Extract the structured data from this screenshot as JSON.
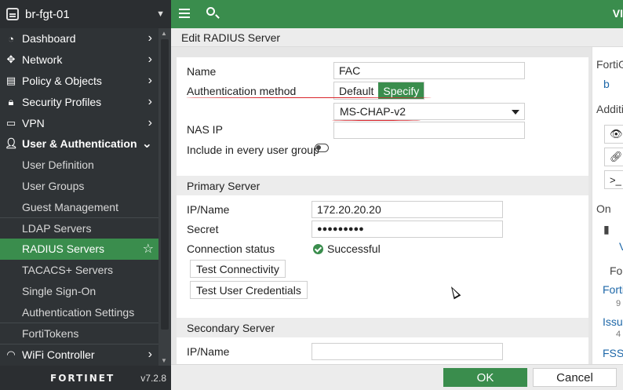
{
  "device": {
    "name": "br-fgt-01"
  },
  "sidebar": {
    "items": [
      {
        "label": "Dashboard",
        "icon": "dashboard-icon"
      },
      {
        "label": "Network",
        "icon": "network-icon"
      },
      {
        "label": "Policy & Objects",
        "icon": "policy-icon"
      },
      {
        "label": "Security Profiles",
        "icon": "lock-icon"
      },
      {
        "label": "VPN",
        "icon": "monitor-icon"
      },
      {
        "label": "User & Authentication",
        "icon": "user-icon"
      },
      {
        "label": "User Definition"
      },
      {
        "label": "User Groups"
      },
      {
        "label": "Guest Management"
      },
      {
        "label": "LDAP Servers"
      },
      {
        "label": "RADIUS Servers"
      },
      {
        "label": "TACACS+ Servers"
      },
      {
        "label": "Single Sign-On"
      },
      {
        "label": "Authentication Settings"
      },
      {
        "label": "FortiTokens"
      },
      {
        "label": "WiFi Controller",
        "icon": "wifi-icon"
      }
    ],
    "brand": "FORTINET",
    "version": "v7.2.8"
  },
  "topbar": {
    "right_text": "VI"
  },
  "dialog": {
    "title": "Edit RADIUS Server",
    "name_label": "Name",
    "name_value": "FAC",
    "auth_method_label": "Authentication method",
    "auth_default": "Default",
    "auth_specify": "Specify",
    "auth_protocol": "MS-CHAP-v2",
    "nas_ip_label": "NAS IP",
    "nas_ip_value": "",
    "include_group_label": "Include in every user group",
    "primary_section": "Primary Server",
    "primary_ip_label": "IP/Name",
    "primary_ip_value": "172.20.20.20",
    "primary_secret_label": "Secret",
    "primary_secret_value": "●●●●●●●●●",
    "conn_status_label": "Connection status",
    "conn_status_value": "Successful",
    "test_connectivity": "Test Connectivity",
    "test_credentials": "Test User Credentials",
    "secondary_section": "Secondary Server",
    "secondary_ip_label": "IP/Name",
    "secondary_ip_value": "",
    "ok": "OK",
    "cancel": "Cancel"
  },
  "rightpane": {
    "forti": "FortiG",
    "b": "b",
    "additi": "Additi",
    "on": "On",
    "fo": "Fo",
    "forti_link": "Forti",
    "count1": "9",
    "issue": "Issue",
    "count2": "4",
    "fssc": "FSSC"
  }
}
